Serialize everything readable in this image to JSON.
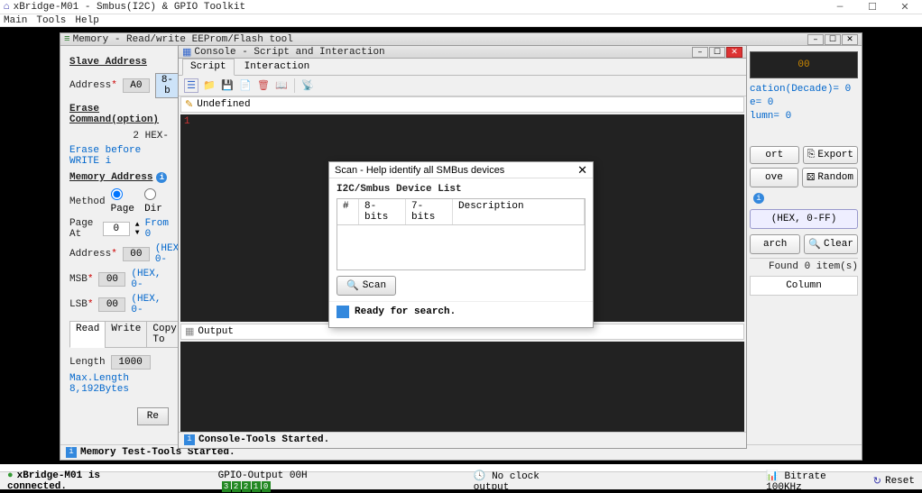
{
  "app": {
    "title": "xBridge-M01 - Smbus(I2C) & GPIO Toolkit",
    "menu": {
      "main": "Main",
      "tools": "Tools",
      "help": "Help"
    }
  },
  "mem": {
    "title": "Memory - Read/write EEProm/Flash tool",
    "slave_hdr": "Slave Address",
    "address_lbl": "Address",
    "address_val": "A0",
    "btn_8b": "8-b",
    "erase_hdr": "Erase Command(option)",
    "hex2": "2 HEX-",
    "erase_before": "Erase before WRITE i",
    "memaddr_hdr": "Memory Address",
    "method_lbl": "Method",
    "radio_page": "Page",
    "radio_dir": "Dir",
    "page_at": "Page At",
    "page_val": "0",
    "from0": "From 0",
    "addr2_lbl": "Address",
    "addr2_val": "00",
    "hex0": "(HEX, 0-",
    "msb": "MSB",
    "msb_val": "00",
    "lsb": "LSB",
    "lsb_val": "00",
    "tab_read": "Read",
    "tab_write": "Write",
    "tab_copy": "Copy To",
    "length_lbl": "Length",
    "length_val": "1000",
    "maxlen": "Max.Length 8,192Bytes",
    "re_btn": "Re",
    "status": "Memory Test-Tools Started."
  },
  "right": {
    "hex_display": "00",
    "cation": "cation(Decade)= 0",
    "e0": "e= 0",
    "lumn0": "lumn= 0",
    "btn_ort": "ort",
    "btn_export": "Export",
    "btn_ove": "ove",
    "btn_random": "Random",
    "hex_range": "(HEX, 0-FF)",
    "btn_arch": "arch",
    "btn_clear": "Clear",
    "found": "Found 0 item(s)",
    "column": "Column"
  },
  "con": {
    "title": "Console - Script and Interaction",
    "tab_script": "Script",
    "tab_inter": "Interaction",
    "undefined": "Undefined",
    "line1": "1",
    "output_lbl": "Output",
    "status": "Console-Tools Started."
  },
  "scan": {
    "title": "Scan - Help identify all SMBus devices",
    "subtitle": "I2C/Smbus Device List",
    "col_num": "#",
    "col_8": "8-bits",
    "col_7": "7-bits",
    "col_desc": "Description",
    "btn": "Scan",
    "ready": "Ready for search."
  },
  "status": {
    "connected": "xBridge-M01 is connected.",
    "gpio": "GPIO-Output 00H",
    "bits": [
      "3",
      "2",
      "2",
      "1",
      "0"
    ],
    "clock": "No clock output",
    "bitrate": "Bitrate 100KHz",
    "reset": "Reset"
  }
}
